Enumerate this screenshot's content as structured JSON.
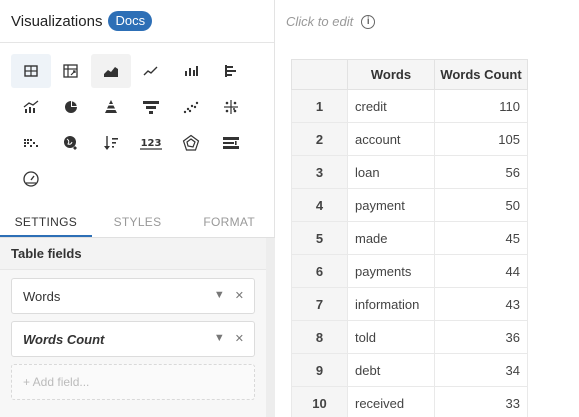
{
  "left": {
    "title": "Visualizations",
    "docs_label": "Docs",
    "viz_rows": [
      [
        {
          "icon": "table-icon",
          "active": true
        },
        {
          "icon": "pivot-table-icon"
        },
        {
          "icon": "area-chart-icon",
          "hover": true
        },
        {
          "icon": "line-chart-icon"
        },
        {
          "icon": "bar-chart-icon"
        },
        {
          "icon": "horizontal-bar-chart-icon"
        }
      ],
      [
        {
          "icon": "combo-chart-icon"
        },
        {
          "icon": "pie-chart-icon"
        },
        {
          "icon": "pyramid-chart-icon"
        },
        {
          "icon": "funnel-chart-icon"
        },
        {
          "icon": "scatter-chart-icon"
        },
        {
          "icon": "pivot-grid-icon"
        }
      ],
      [
        {
          "icon": "heatmap-icon"
        },
        {
          "icon": "geo-map-icon"
        },
        {
          "icon": "sort-chart-icon"
        },
        {
          "icon": "number-icon"
        },
        {
          "icon": "radar-chart-icon"
        },
        {
          "icon": "bullet-chart-icon"
        }
      ],
      [
        {
          "icon": "gauge-icon"
        }
      ]
    ],
    "tabs": [
      "SETTINGS",
      "STYLES",
      "FORMAT"
    ],
    "fields_title": "Table fields",
    "fields": [
      "Words",
      "Words Count"
    ],
    "add_field_placeholder": "+ Add field..."
  },
  "right": {
    "click_to_edit": "Click to edit",
    "table": {
      "headers": [
        "",
        "Words",
        "Words Count"
      ],
      "rows": [
        [
          "1",
          "credit",
          "110"
        ],
        [
          "2",
          "account",
          "105"
        ],
        [
          "3",
          "loan",
          "56"
        ],
        [
          "4",
          "payment",
          "50"
        ],
        [
          "5",
          "made",
          "45"
        ],
        [
          "6",
          "payments",
          "44"
        ],
        [
          "7",
          "information",
          "43"
        ],
        [
          "8",
          "told",
          "36"
        ],
        [
          "9",
          "debt",
          "34"
        ],
        [
          "10",
          "received",
          "33"
        ]
      ]
    }
  },
  "colors": {
    "accent": "#2d6fb6"
  }
}
